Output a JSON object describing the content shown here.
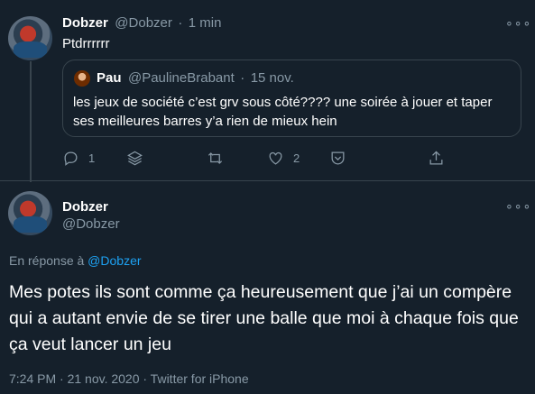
{
  "tweet1": {
    "name": "Dobzer",
    "handle": "@Dobzer",
    "sep": "·",
    "time": "1 min",
    "text": "Ptdrrrrrr",
    "quote": {
      "name": "Pau",
      "handle": "@PaulineBrabant",
      "sep": "·",
      "time": "15 nov.",
      "text": "les jeux de société c’est grv sous côté???? une soirée à jouer et taper ses meilleures barres y’a rien de mieux hein"
    },
    "actions": {
      "reply_count": "1",
      "like_count": "2"
    }
  },
  "tweet2": {
    "name": "Dobzer",
    "handle": "@Dobzer",
    "reply_prefix": "En réponse à ",
    "reply_handle": "@Dobzer",
    "text": "Mes potes ils sont comme ça heureusement que j’ai un compère qui a autant envie de se tirer une balle que moi à chaque fois que ça veut lancer un jeu",
    "meta": "7:24 PM · 21 nov. 2020 · Twitter for iPhone"
  },
  "icons": {
    "more": "more-icon",
    "reply": "reply-icon",
    "stack": "stack-icon",
    "retweet": "retweet-icon",
    "like": "heart-icon",
    "save": "save-icon",
    "share": "share-icon"
  },
  "colors": {
    "background": "#15202b",
    "muted": "#8899a6",
    "link": "#1da1f2",
    "border": "#38444d"
  }
}
